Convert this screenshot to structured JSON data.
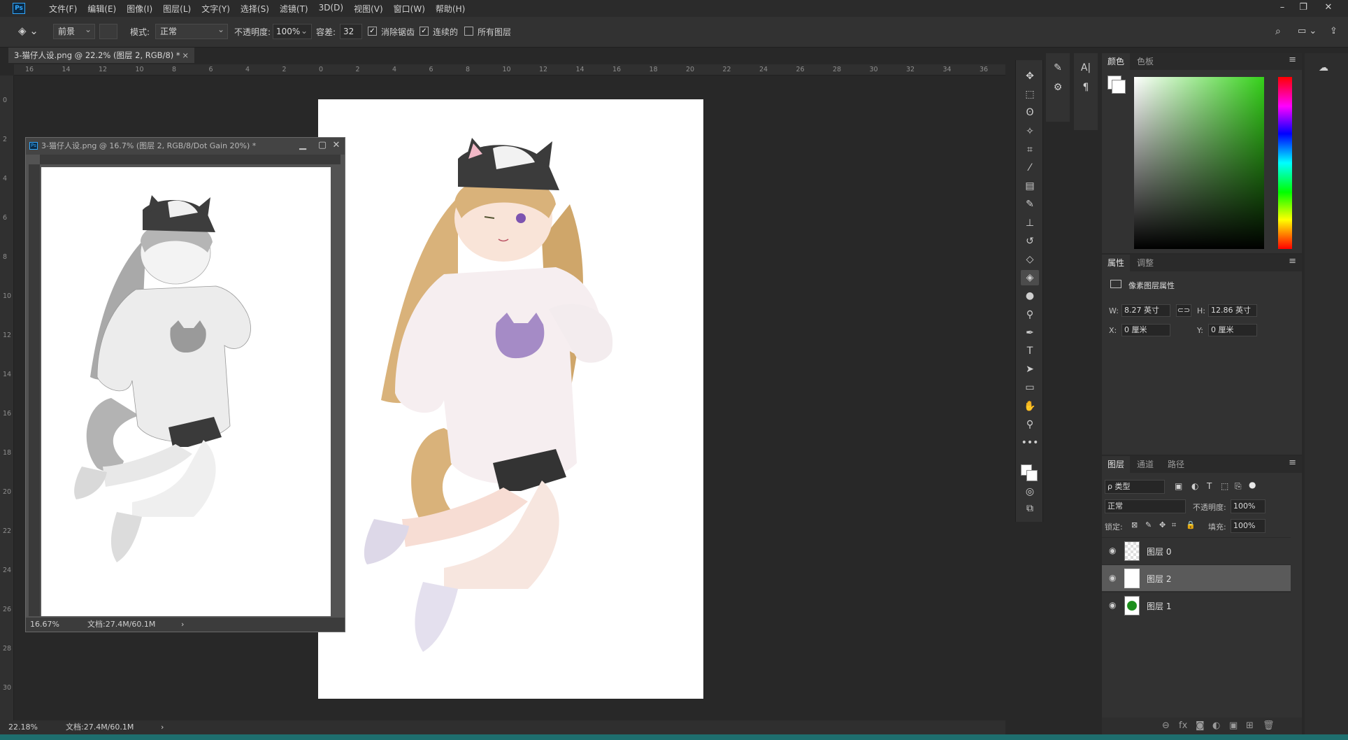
{
  "app": {
    "logo": "Ps",
    "menu": [
      "文件(F)",
      "编辑(E)",
      "图像(I)",
      "图层(L)",
      "文字(Y)",
      "选择(S)",
      "滤镜(T)",
      "3D(D)",
      "视图(V)",
      "窗口(W)",
      "帮助(H)"
    ],
    "window_controls": [
      "–",
      "❐",
      "✕"
    ]
  },
  "options": {
    "fill_source": "前景",
    "mode_label": "模式:",
    "mode_value": "正常",
    "opacity_label": "不透明度:",
    "opacity_value": "100%",
    "tolerance_label": "容差:",
    "tolerance_value": "32",
    "antialias_label": "消除锯齿",
    "antialias_checked": true,
    "contiguous_label": "连续的",
    "contiguous_checked": true,
    "all_layers_label": "所有图层",
    "all_layers_checked": false
  },
  "document_tab": {
    "title": "3-猫仔人设.png @ 22.2% (图层 2, RGB/8) *",
    "close": "×"
  },
  "ruler": {
    "h_ticks": [
      "16",
      "14",
      "12",
      "10",
      "8",
      "6",
      "4",
      "2",
      "0",
      "2",
      "4",
      "6",
      "8",
      "10",
      "12",
      "14",
      "16",
      "18",
      "20",
      "22",
      "24",
      "26",
      "28",
      "30",
      "32",
      "34",
      "36"
    ],
    "v_ticks": [
      "0",
      "2",
      "4",
      "6",
      "8",
      "1 0",
      "1 2",
      "1 4",
      "1 6",
      "1 8",
      "2 0",
      "2 2",
      "2 4",
      "2 6",
      "2 8",
      "3 0"
    ]
  },
  "float_window": {
    "title": "3-猫仔人设.png @ 16.7% (图层 2, RGB/8/Dot Gain 20%) *",
    "zoom": "16.67%",
    "doc_info": "文档:27.4M/60.1M",
    "arrow": "›"
  },
  "statusbar": {
    "zoom": "22.18%",
    "doc_info": "文档:27.4M/60.1M",
    "arrow": "›"
  },
  "tools": [
    {
      "name": "move-tool",
      "glyph": "✥"
    },
    {
      "name": "marquee-tool",
      "glyph": "⬚"
    },
    {
      "name": "lasso-tool",
      "glyph": "ʘ"
    },
    {
      "name": "magic-wand-tool",
      "glyph": "✧"
    },
    {
      "name": "crop-tool",
      "glyph": "⌗"
    },
    {
      "name": "eyedropper-tool",
      "glyph": "⁄"
    },
    {
      "name": "healing-brush-tool",
      "glyph": "▤"
    },
    {
      "name": "brush-tool",
      "glyph": "✎"
    },
    {
      "name": "clone-stamp-tool",
      "glyph": "⊥"
    },
    {
      "name": "history-brush-tool",
      "glyph": "↺"
    },
    {
      "name": "eraser-tool",
      "glyph": "◇"
    },
    {
      "name": "paint-bucket-tool",
      "glyph": "◈"
    },
    {
      "name": "blur-tool",
      "glyph": "●"
    },
    {
      "name": "dodge-tool",
      "glyph": "⚲"
    },
    {
      "name": "pen-tool",
      "glyph": "✒"
    },
    {
      "name": "type-tool",
      "glyph": "T"
    },
    {
      "name": "path-selection-tool",
      "glyph": "➤"
    },
    {
      "name": "rectangle-tool",
      "glyph": "▭"
    },
    {
      "name": "hand-tool",
      "glyph": "✋"
    },
    {
      "name": "zoom-tool",
      "glyph": "⚲"
    },
    {
      "name": "more-tools",
      "glyph": "•••"
    }
  ],
  "color_panel": {
    "tabs": [
      "颜色",
      "色板"
    ],
    "menu": "≡"
  },
  "properties_panel": {
    "tabs": [
      "属性",
      "调整"
    ],
    "menu": "≡",
    "heading": "像素图层属性",
    "w_label": "W:",
    "w_value": "8.27 英寸",
    "h_label": "H:",
    "h_value": "12.86 英寸",
    "x_label": "X:",
    "x_value": "0 厘米",
    "y_label": "Y:",
    "y_value": "0 厘米",
    "link_icon": "⊂⊃"
  },
  "layers_panel": {
    "tabs": [
      "图层",
      "通道",
      "路径"
    ],
    "menu": "≡",
    "filter_label": "ρ 类型",
    "blend_mode": "正常",
    "opacity_label": "不透明度:",
    "opacity_value": "100%",
    "lock_label": "锁定:",
    "fill_label": "填充:",
    "fill_value": "100%",
    "layers": [
      {
        "name": "图层 0",
        "selected": false,
        "thumb": "checker"
      },
      {
        "name": "图层 2",
        "selected": true,
        "thumb": "white"
      },
      {
        "name": "图层 1",
        "selected": false,
        "thumb": "green"
      }
    ],
    "bottom_icons": [
      "⊖",
      "fx",
      "◙",
      "◐",
      "▣",
      "⊞",
      "🗑"
    ]
  },
  "colors": {
    "accent": "#31a8ff",
    "background": "#282828",
    "panel": "#323232",
    "taskbar": "#1e6e6e"
  }
}
